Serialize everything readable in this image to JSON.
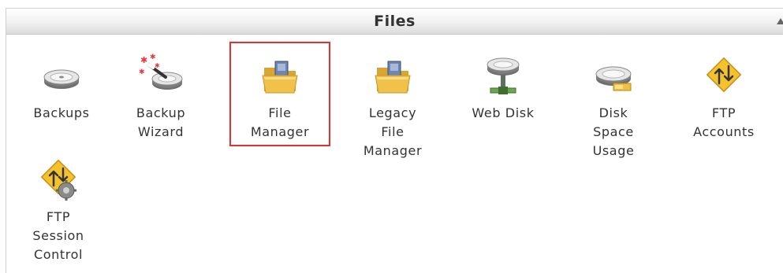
{
  "section": {
    "title": "Files"
  },
  "items": [
    {
      "label": "Backups",
      "icon": "hard-drive-icon"
    },
    {
      "label": "Backup\nWizard",
      "icon": "backup-wizard-icon"
    },
    {
      "label": "File\nManager",
      "icon": "folder-icon"
    },
    {
      "label": "Legacy\nFile\nManager",
      "icon": "folder-icon"
    },
    {
      "label": "Web Disk",
      "icon": "network-drive-icon"
    },
    {
      "label": "Disk\nSpace\nUsage",
      "icon": "disk-usage-icon"
    },
    {
      "label": "FTP\nAccounts",
      "icon": "ftp-arrows-icon"
    },
    {
      "label": "FTP\nSession\nControl",
      "icon": "ftp-session-icon"
    }
  ],
  "colors": {
    "highlight": "#e53030",
    "folder": "#f2c14a",
    "ftp": "#f6c22c"
  }
}
